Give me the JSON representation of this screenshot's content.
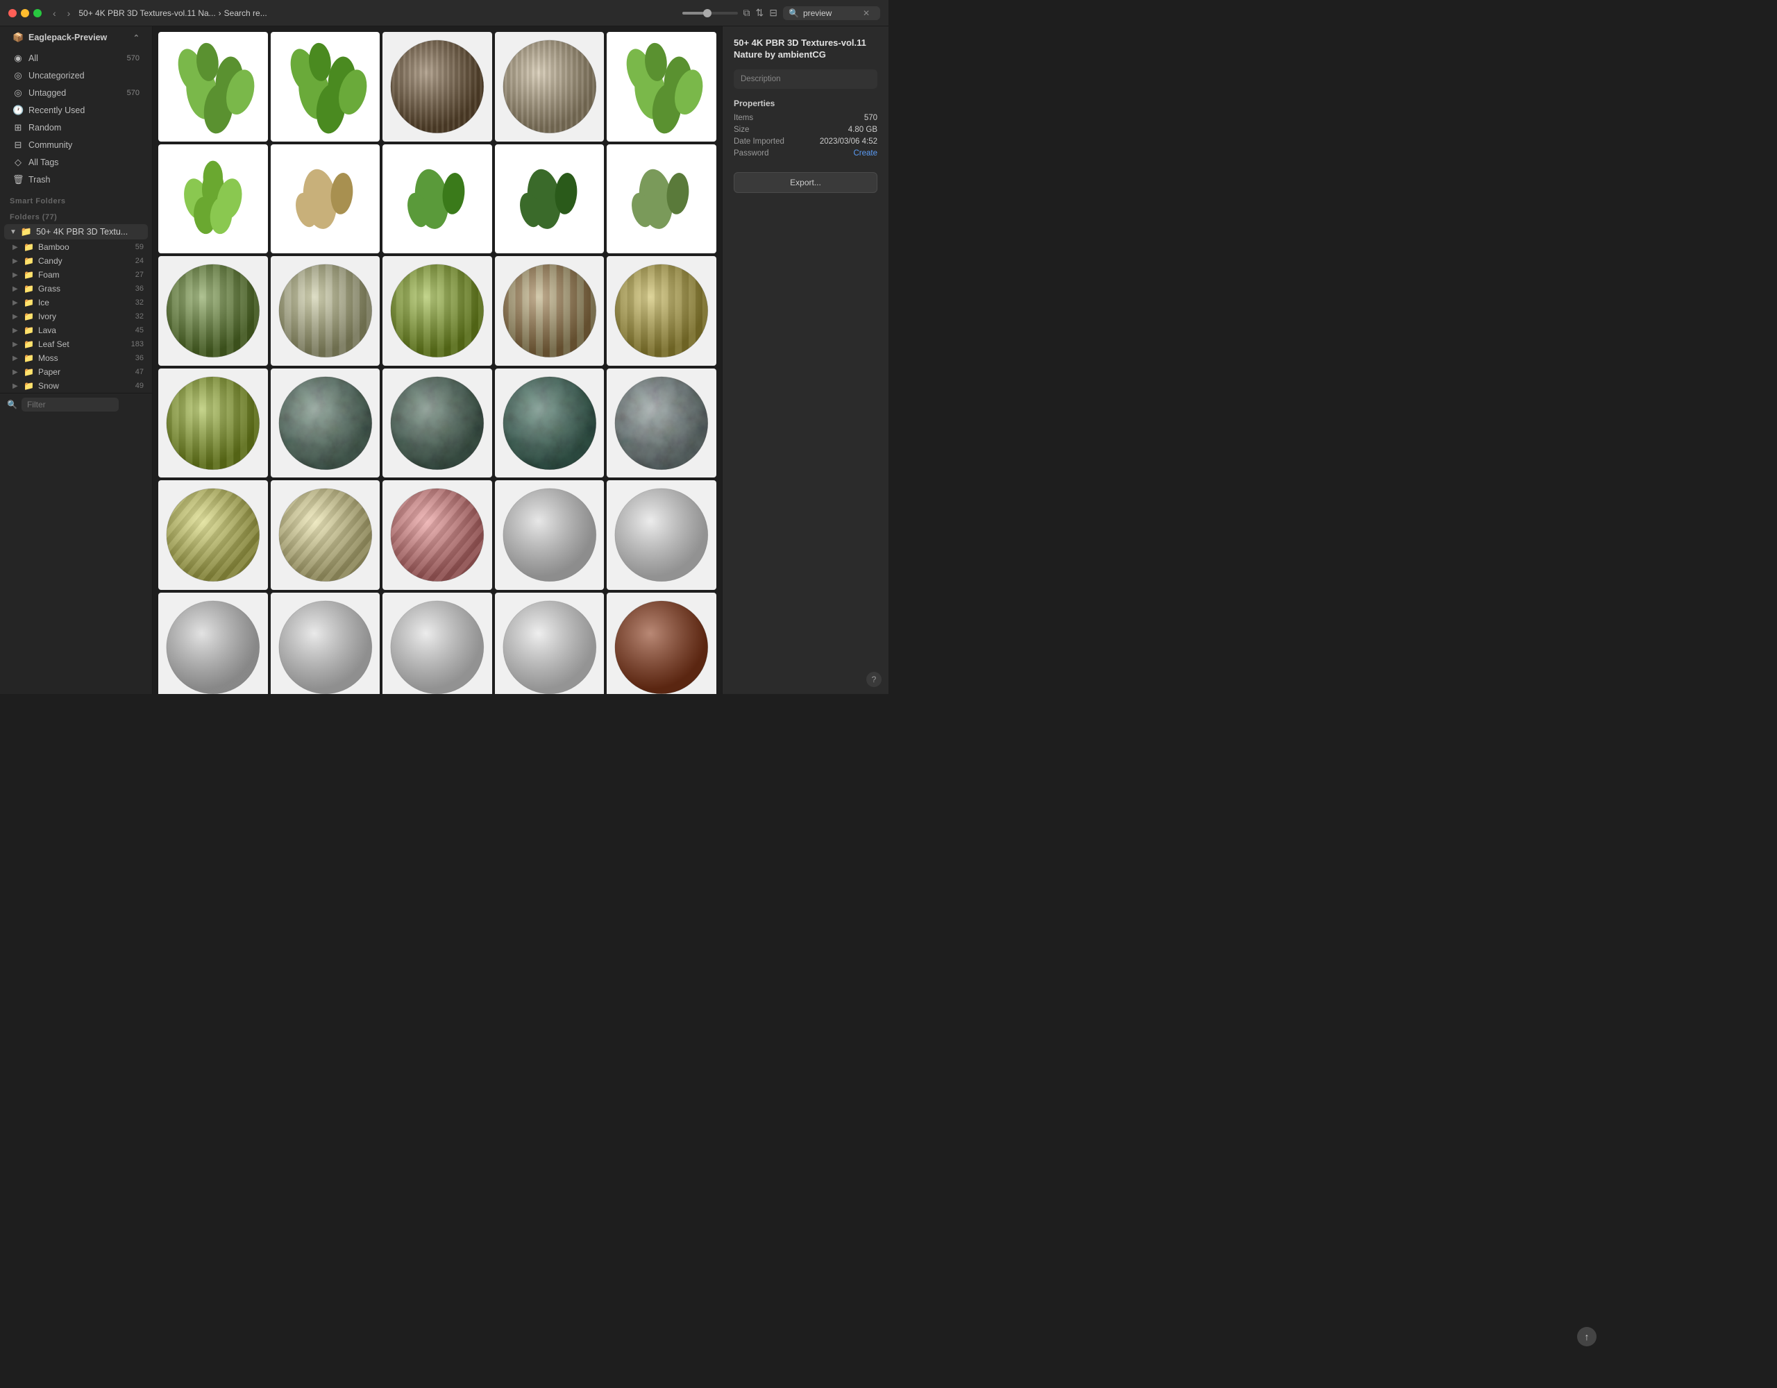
{
  "titlebar": {
    "title": "Eaglepack-Preview",
    "breadcrumb": [
      "50+ 4K PBR 3D Textures-vol.11 Na...",
      "Search re..."
    ],
    "search_placeholder": "preview",
    "back_label": "‹",
    "forward_label": "›"
  },
  "sidebar": {
    "library_label": "Eaglepack-Preview",
    "nav_items": [
      {
        "id": "all",
        "icon": "◉",
        "label": "All",
        "count": "570"
      },
      {
        "id": "uncategorized",
        "icon": "◎",
        "label": "Uncategorized",
        "count": ""
      },
      {
        "id": "untagged",
        "icon": "◎",
        "label": "Untagged",
        "count": "570"
      },
      {
        "id": "recently-used",
        "icon": "🕐",
        "label": "Recently Used",
        "count": ""
      },
      {
        "id": "random",
        "icon": "⊞",
        "label": "Random",
        "count": ""
      },
      {
        "id": "community",
        "icon": "⊟",
        "label": "Community",
        "count": ""
      },
      {
        "id": "all-tags",
        "icon": "◇",
        "label": "All Tags",
        "count": ""
      },
      {
        "id": "trash",
        "icon": "🗑",
        "label": "Trash",
        "count": ""
      }
    ],
    "smart_folders_label": "Smart Folders",
    "folders_label": "Folders (77)",
    "active_folder": "50+ 4K PBR 3D Textu...",
    "subfolders": [
      {
        "label": "Bamboo",
        "count": "59"
      },
      {
        "label": "Candy",
        "count": "24"
      },
      {
        "label": "Foam",
        "count": "27"
      },
      {
        "label": "Grass",
        "count": "36"
      },
      {
        "label": "Ice",
        "count": "32"
      },
      {
        "label": "Ivory",
        "count": "32"
      },
      {
        "label": "Lava",
        "count": "45"
      },
      {
        "label": "Leaf Set",
        "count": "183"
      },
      {
        "label": "Moss",
        "count": "36"
      },
      {
        "label": "Paper",
        "count": "47"
      },
      {
        "label": "Snow",
        "count": "49"
      }
    ],
    "filter_placeholder": "Filter"
  },
  "right_panel": {
    "title": "50+ 4K PBR 3D Textures-vol.11 Nature by ambientCG",
    "description_placeholder": "Description",
    "properties_label": "Properties",
    "props": [
      {
        "label": "Items",
        "value": "570",
        "is_link": false
      },
      {
        "label": "Size",
        "value": "4.80 GB",
        "is_link": false
      },
      {
        "label": "Date Imported",
        "value": "2023/03/06 4:52",
        "is_link": false
      },
      {
        "label": "Password",
        "value": "Create",
        "is_link": true
      }
    ],
    "export_label": "Export..."
  },
  "grid": {
    "rows": 7,
    "cols": 5,
    "items": [
      {
        "type": "leaf",
        "colors": [
          "#7ab84a",
          "#5a9130"
        ]
      },
      {
        "type": "leaf",
        "colors": [
          "#6aaa3a",
          "#4a8a20"
        ]
      },
      {
        "type": "sphere",
        "texture": "bark",
        "colors": [
          "#8B7355",
          "#6B5335"
        ]
      },
      {
        "type": "sphere",
        "texture": "bark-light",
        "colors": [
          "#c8b89a",
          "#a89878"
        ]
      },
      {
        "type": "leaf",
        "colors": [
          "#7ab84a",
          "#5a9130"
        ]
      },
      {
        "type": "leaf-multi",
        "colors": [
          "#8ac850",
          "#6aa830"
        ]
      },
      {
        "type": "leaf-tan",
        "colors": [
          "#c8b07a",
          "#a89050"
        ]
      },
      {
        "type": "leaf-small",
        "colors": [
          "#5a9a3a",
          "#3a7a1a"
        ]
      },
      {
        "type": "leaf-dark",
        "colors": [
          "#3a6a2a",
          "#2a5a1a"
        ]
      },
      {
        "type": "leaf-fern",
        "colors": [
          "#7a9a5a",
          "#5a7a3a"
        ]
      },
      {
        "type": "sphere",
        "texture": "bamboo-green",
        "colors": [
          "#7a9a4a",
          "#5a7a2a"
        ]
      },
      {
        "type": "sphere",
        "texture": "bamboo-light",
        "colors": [
          "#c8c8a0",
          "#a8a878"
        ]
      },
      {
        "type": "sphere",
        "texture": "bamboo-bright",
        "colors": [
          "#9ab840",
          "#7a9820"
        ]
      },
      {
        "type": "sphere",
        "texture": "bamboo-tan",
        "colors": [
          "#b8a878",
          "#987848"
        ]
      },
      {
        "type": "sphere",
        "texture": "bamboo-yellow",
        "colors": [
          "#c8b858",
          "#a89838"
        ]
      },
      {
        "type": "sphere",
        "texture": "bamboo-lime",
        "colors": [
          "#a0b840",
          "#809820"
        ]
      },
      {
        "type": "sphere",
        "texture": "marble-gray",
        "colors": [
          "#6a8a7a",
          "#4a6a5a"
        ]
      },
      {
        "type": "sphere",
        "texture": "marble-dark",
        "colors": [
          "#5a7a6a",
          "#3a5a4a"
        ]
      },
      {
        "type": "sphere",
        "texture": "marble-teal",
        "colors": [
          "#4a7a6a",
          "#2a5a4a"
        ]
      },
      {
        "type": "sphere",
        "texture": "marble-light",
        "colors": [
          "#8a9a9a",
          "#6a7a7a"
        ]
      },
      {
        "type": "sphere",
        "texture": "candy-yellow",
        "colors": [
          "#d8d870",
          "#b8b850"
        ]
      },
      {
        "type": "sphere",
        "texture": "candy-tan",
        "colors": [
          "#e8e0a0",
          "#c8c080"
        ]
      },
      {
        "type": "sphere",
        "texture": "candy-pink",
        "colors": [
          "#e89090",
          "#c87070"
        ]
      },
      {
        "type": "sphere",
        "texture": "foam-white",
        "colors": [
          "#d8d8d8",
          "#b8b8b8"
        ]
      },
      {
        "type": "sphere",
        "texture": "foam-light",
        "colors": [
          "#e0e0e0",
          "#c0c0c0"
        ]
      },
      {
        "type": "sphere",
        "texture": "snow-white",
        "colors": [
          "#d0d0d0",
          "#b0b0b0"
        ]
      },
      {
        "type": "sphere",
        "texture": "snow-light",
        "colors": [
          "#dcdcdc",
          "#bcbcbc"
        ]
      },
      {
        "type": "sphere",
        "texture": "snow-pure",
        "colors": [
          "#e0e0e0",
          "#c8c8c8"
        ]
      },
      {
        "type": "sphere",
        "texture": "snow-bright",
        "colors": [
          "#e4e4e4",
          "#cccccc"
        ]
      },
      {
        "type": "sphere",
        "texture": "lava-red",
        "colors": [
          "#8B3A1A",
          "#6B1A00"
        ]
      }
    ]
  },
  "icons": {
    "search": "🔍",
    "filter": "⧉",
    "sort": "⇅",
    "view": "⊞",
    "bell": "🔔",
    "refresh": "↻",
    "add": "+",
    "sidebar_toggle": "⊟",
    "chevron_right": "›",
    "chevron_down": "▾",
    "folder": "📁",
    "up_arrow": "↑",
    "question": "?",
    "expand": "▶"
  },
  "colors": {
    "sidebar_bg": "#252525",
    "content_bg": "#1e1e1e",
    "titlebar_bg": "#2b2b2b",
    "active_folder": "#3a5a8a",
    "accent": "#4a8af4"
  }
}
